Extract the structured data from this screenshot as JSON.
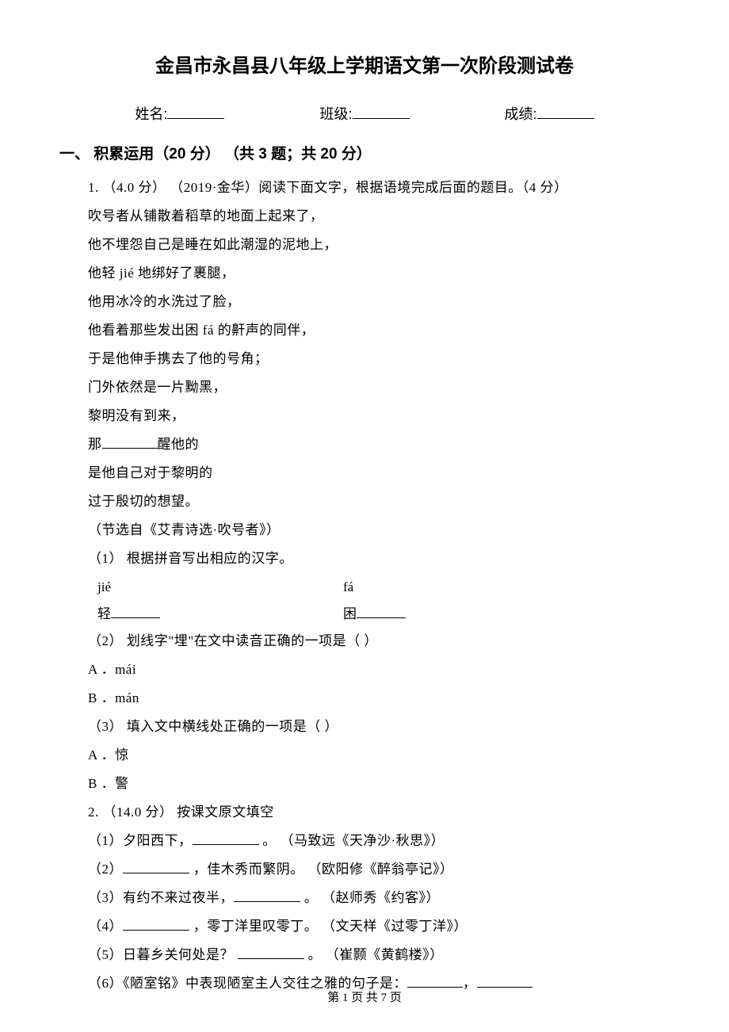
{
  "title": "金昌市永昌县八年级上学期语文第一次阶段测试卷",
  "info": {
    "name_label": "姓名:",
    "class_label": "班级:",
    "score_label": "成绩:"
  },
  "section1": {
    "heading": "一、 积累运用（20 分） （共 3 题；共 20 分）",
    "q1": {
      "intro": "1. （4.0 分） （2019·金华）阅读下面文字，根据语境完成后面的题目。（4 分）",
      "lines": [
        "吹号者从铺散着稻草的地面上起来了，",
        "他不埋怨自己是睡在如此潮湿的泥地上，",
        "他轻 jié 地绑好了裹腿，",
        "他用冰冷的水洗过了脸，",
        "他看着那些发出困 fá 的鼾声的同伴，",
        "于是他伸手携去了他的号角；",
        "门外依然是一片黝黑，",
        "黎明没有到来，"
      ],
      "blank_line_prefix": "那",
      "blank_line_suffix": "醒他的",
      "lines2": [
        "是他自己对于黎明的",
        "过于殷切的想望。",
        "（节选自《艾青诗选·吹号者》）"
      ],
      "sub1": "（1） 根据拼音写出相应的汉字。",
      "pinyin_jie": "jié",
      "pinyin_fa": "fá",
      "qing": "轻",
      "kun": "困",
      "sub2": "（2） 划线字\"埋\"在文中读音正确的一项是（    ）",
      "optA1": "A ．mái",
      "optB1": "B ．mán",
      "sub3": "（3） 填入文中横线处正确的一项是（    ）",
      "optA2": "A ．惊",
      "optB2": "B ．警"
    },
    "q2": {
      "intro": "2. （14.0 分） 按课文原文填空",
      "items": [
        {
          "pre": "（1）夕阳西下，",
          "post": "     。      （马致远《天净沙·秋思》）"
        },
        {
          "pre": "（2）",
          "post": "     ，佳木秀而繁阴。      （欧阳修《醉翁亭记》）"
        },
        {
          "pre": "（3）有约不来过夜半，",
          "post": "     。   （赵师秀《约客》）"
        },
        {
          "pre": "（4）",
          "post": "     ，零丁洋里叹零丁。   （文天样《过零丁洋》）"
        },
        {
          "pre": "（5）日暮乡关何处是？   ",
          "post": "     。    （崔颢《黄鹤楼》）"
        }
      ],
      "item6_pre": "（6）《陋室铭》中表现陋室主人交往之雅的句子是：",
      "item6_mid": "，"
    }
  },
  "footer": "第 1 页 共 7 页"
}
